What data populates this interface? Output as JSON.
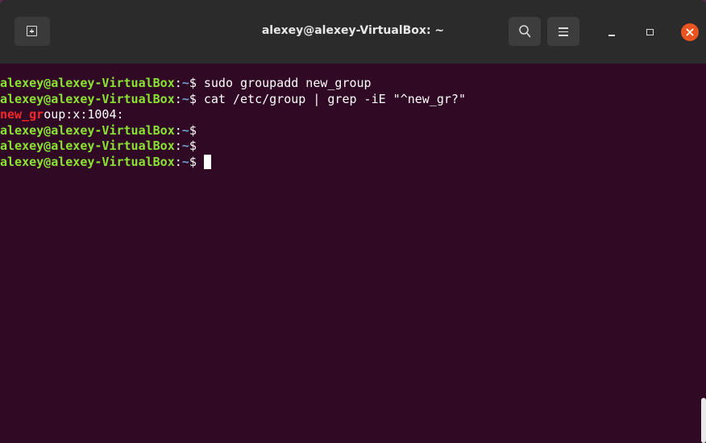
{
  "window": {
    "title": "alexey@alexey-VirtualBox: ~"
  },
  "icons": {
    "new_tab": "new-tab-icon",
    "search": "search-icon",
    "menu": "hamburger-menu-icon",
    "minimize": "minimize-icon",
    "maximize": "maximize-icon",
    "close": "close-icon"
  },
  "colors": {
    "terminal_background": "#300a24",
    "titlebar_background": "#2b2b2b",
    "prompt_user_host": "#8ae234",
    "prompt_path": "#729fcf",
    "grep_match": "#ef2929",
    "close_button": "#e95420"
  },
  "terminal": {
    "prompt_user_host": "alexey@alexey-VirtualBox",
    "prompt_separator": ":",
    "prompt_path": "~",
    "prompt_symbol": "$ ",
    "lines": [
      {
        "command": "sudo groupadd new_group"
      },
      {
        "command": "cat /etc/group | grep -iE \"^new_gr?\""
      },
      {
        "output_match": "new_gr",
        "output_rest": "oup:x:1004:"
      },
      {
        "command": ""
      },
      {
        "command": ""
      },
      {
        "command": ""
      }
    ]
  }
}
